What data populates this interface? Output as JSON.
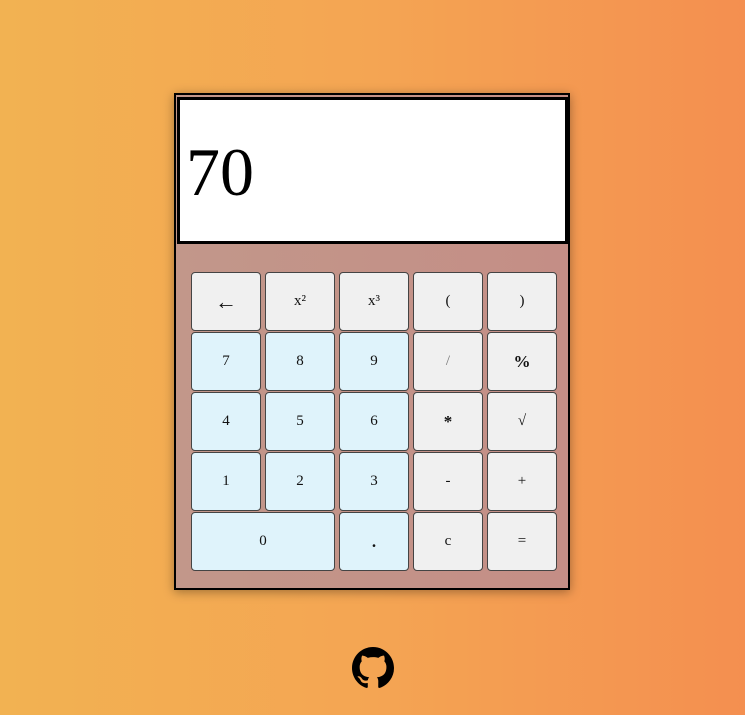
{
  "calculator": {
    "display": "70",
    "keys": [
      {
        "name": "backspace-button",
        "label": "←",
        "type": "op"
      },
      {
        "name": "square-button",
        "label": "x²",
        "type": "op"
      },
      {
        "name": "cube-button",
        "label": "x³",
        "type": "op"
      },
      {
        "name": "open-paren-button",
        "label": "(",
        "type": "op"
      },
      {
        "name": "close-paren-button",
        "label": ")",
        "type": "op"
      },
      {
        "name": "digit-7-button",
        "label": "7",
        "type": "num"
      },
      {
        "name": "digit-8-button",
        "label": "8",
        "type": "num"
      },
      {
        "name": "digit-9-button",
        "label": "9",
        "type": "num"
      },
      {
        "name": "divide-button",
        "label": "/",
        "type": "op"
      },
      {
        "name": "percent-button",
        "label": "%",
        "type": "op"
      },
      {
        "name": "digit-4-button",
        "label": "4",
        "type": "num"
      },
      {
        "name": "digit-5-button",
        "label": "5",
        "type": "num"
      },
      {
        "name": "digit-6-button",
        "label": "6",
        "type": "num"
      },
      {
        "name": "multiply-button",
        "label": "*",
        "type": "op"
      },
      {
        "name": "sqrt-button",
        "label": "√",
        "type": "op"
      },
      {
        "name": "digit-1-button",
        "label": "1",
        "type": "num"
      },
      {
        "name": "digit-2-button",
        "label": "2",
        "type": "num"
      },
      {
        "name": "digit-3-button",
        "label": "3",
        "type": "num"
      },
      {
        "name": "minus-button",
        "label": "-",
        "type": "op"
      },
      {
        "name": "plus-button",
        "label": "+",
        "type": "op"
      },
      {
        "name": "digit-0-button",
        "label": "0",
        "type": "num"
      },
      {
        "name": "decimal-button",
        "label": ".",
        "type": "num"
      },
      {
        "name": "clear-button",
        "label": "c",
        "type": "op"
      },
      {
        "name": "equals-button",
        "label": "=",
        "type": "op"
      }
    ]
  },
  "footer": {
    "icon": "github-icon"
  },
  "colors": {
    "number_key": "#dff3fb",
    "operator_key": "#f0f0f0"
  }
}
